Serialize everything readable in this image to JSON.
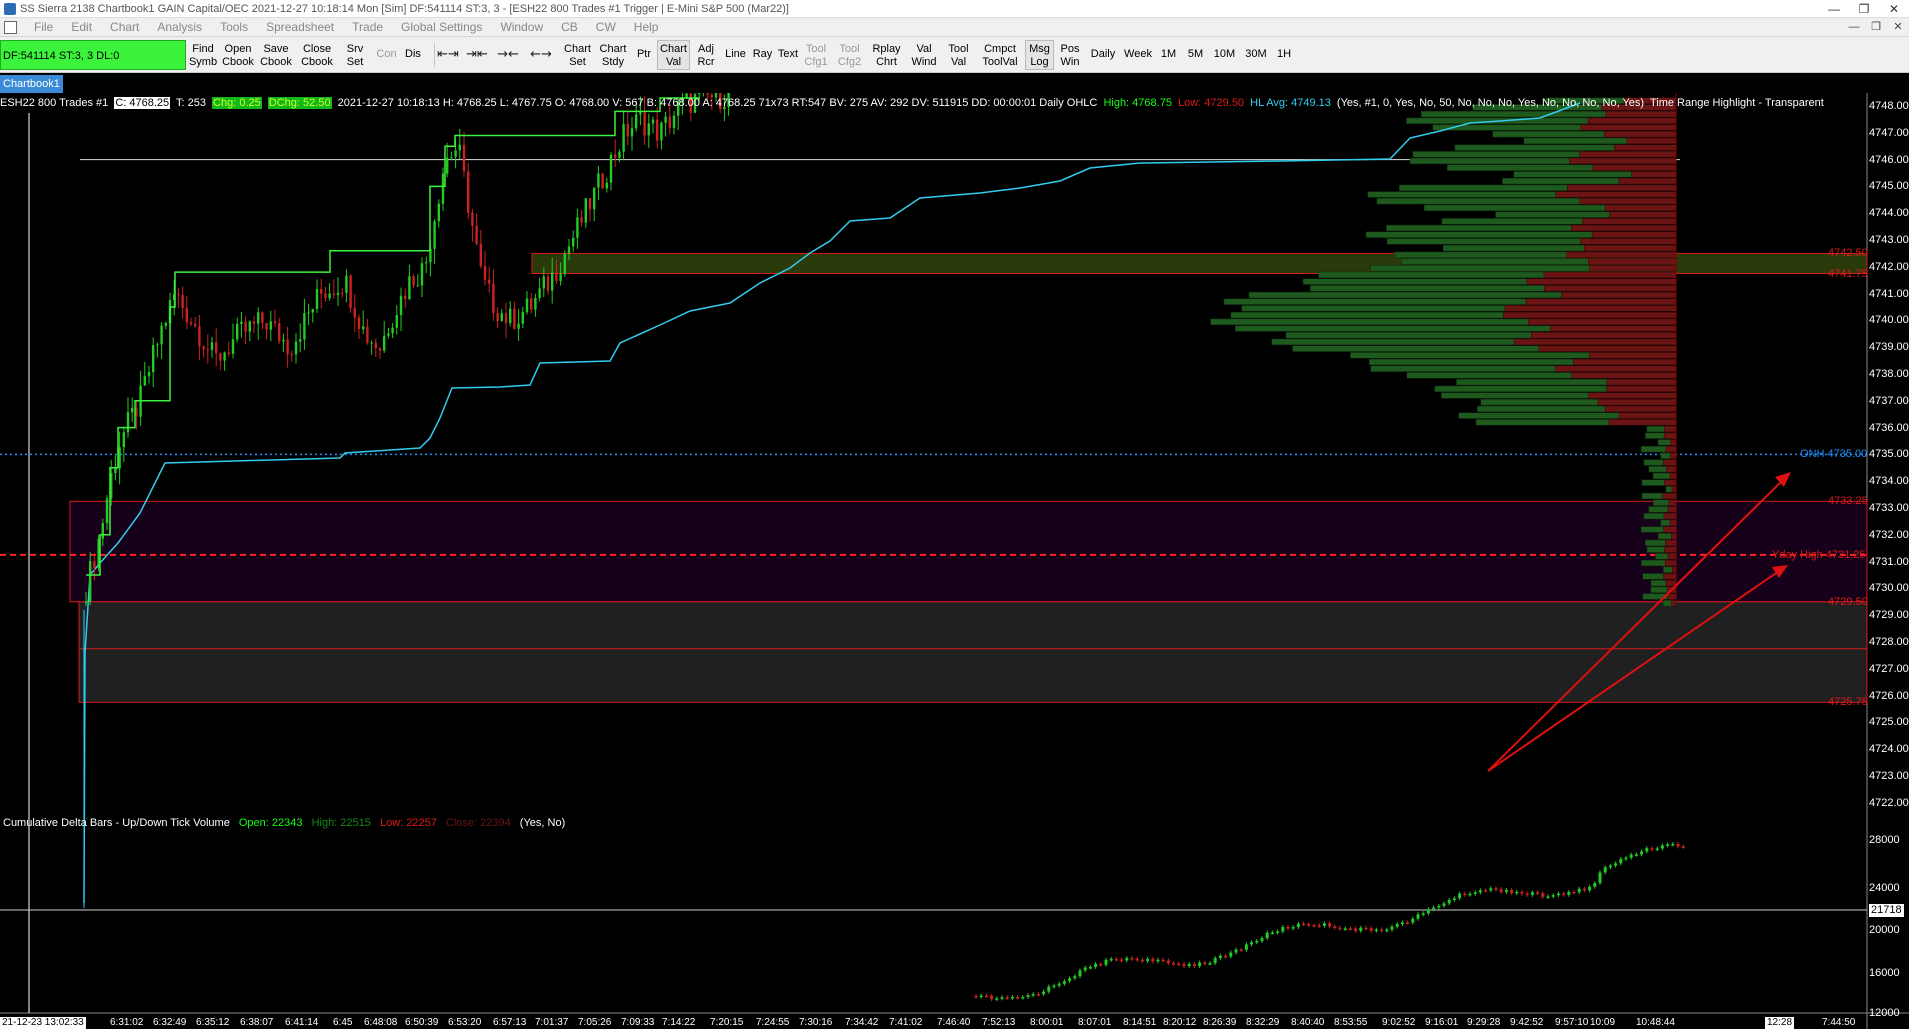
{
  "window": {
    "title": "SS Sierra 2138 Chartbook1  GAIN Capital/OEC 2021-12-27  10:18:14 Mon [Sim]  DF:541114  ST:3, 3  - [ESH22  800 Trades  #1  Trigger | E-Mini S&P 500 (Mar22)]"
  },
  "menu": [
    "File",
    "Edit",
    "Chart",
    "Analysis",
    "Tools",
    "Spreadsheet",
    "Trade",
    "Global Settings",
    "Window",
    "CB",
    "CW",
    "Help"
  ],
  "toolbar": {
    "status": "DF:541114  ST:3, 3  DL:0",
    "buttons": [
      {
        "label": "Find\nSymb",
        "dim": false
      },
      {
        "label": "Open\nCbook",
        "dim": false
      },
      {
        "label": "Save\nCbook",
        "dim": false
      },
      {
        "label": "Close\nCbook",
        "dim": false
      },
      {
        "label": "Srv\nSet",
        "dim": false
      },
      {
        "label": "Con",
        "dim": true
      },
      {
        "label": "Dis",
        "dim": false
      }
    ],
    "buttons2": [
      {
        "label": "Chart\nSet",
        "dim": false
      },
      {
        "label": "Chart\nStdy",
        "dim": false
      },
      {
        "label": "Ptr",
        "dim": false
      },
      {
        "label": "Chart\nVal",
        "dim": false,
        "active": true
      },
      {
        "label": "Adj\nRcr",
        "dim": false
      },
      {
        "label": "Line",
        "dim": false
      },
      {
        "label": "Ray",
        "dim": false
      },
      {
        "label": "Text",
        "dim": false
      },
      {
        "label": "Tool\nCfg1",
        "dim": true
      },
      {
        "label": "Tool\nCfg2",
        "dim": true
      },
      {
        "label": "Rplay\nChrt",
        "dim": false
      },
      {
        "label": "Val\nWind",
        "dim": false
      },
      {
        "label": "Tool\nVal",
        "dim": false
      },
      {
        "label": "Cmpct\nToolVal",
        "dim": false
      },
      {
        "label": "Msg\nLog",
        "dim": false,
        "active": true
      },
      {
        "label": "Pos\nWin",
        "dim": false
      },
      {
        "label": "Daily",
        "dim": false
      },
      {
        "label": "Week",
        "dim": false
      },
      {
        "label": "1M",
        "dim": false
      },
      {
        "label": "5M",
        "dim": false
      },
      {
        "label": "10M",
        "dim": false
      },
      {
        "label": "30M",
        "dim": false
      },
      {
        "label": "1H",
        "dim": false
      }
    ],
    "icons": [
      "zoom-in-horizontal-icon",
      "zoom-out-horizontal-icon",
      "compress-bars-icon",
      "expand-bars-icon"
    ]
  },
  "tab": "Chartbook1",
  "chart": {
    "header": {
      "symbol": "ESH22  800 Trades  #1",
      "c": "C: 4768.25",
      "t": "T: 253",
      "chg": "Chg: 0.25",
      "dchg": "DChg: 52.50",
      "info": "2021-12-27 10:18:13  H: 4768.25  L: 4767.75  O: 4768.00  V: 567  B: 4768.00  A: 4768.25  71x73  RT:547  BV: 275  AV: 292  DV: 511915  DD: 00:00:01  Daily OHLC",
      "high": "High: 4768.75",
      "low": "Low: 4729.50",
      "hlavg": "HL Avg: 4749.13",
      "flags": "(Yes, #1, 0, Yes, No, 50, No, No, No, Yes, No, No, No, No, Yes)",
      "trh": "Time Range Highlight - Transparent"
    },
    "subgraph": {
      "name": "Cumulative Delta Bars - Up/Down Tick Volume",
      "open": "Open: 22343",
      "high": "High: 22515",
      "low": "Low: 22257",
      "close": "Close: 22394",
      "flags": "(Yes, No)"
    },
    "price_axis": [
      "4748.00",
      "4747.00",
      "4746.00",
      "4745.00",
      "4744.00",
      "4743.00",
      "4742.00",
      "4741.00",
      "4740.00",
      "4739.00",
      "4738.00",
      "4737.00",
      "4736.00",
      "4735.00",
      "4734.00",
      "4733.00",
      "4732.00",
      "4731.00",
      "4730.00",
      "4729.00",
      "4728.00",
      "4727.00",
      "4726.00",
      "4725.00",
      "4724.00",
      "4723.00",
      "4722.00"
    ],
    "delta_axis": [
      "28000",
      "24000",
      "20000",
      "16000",
      "12000"
    ],
    "delta_marker": "21718",
    "levels": [
      {
        "label": "4742.50",
        "color": "#d81a1a"
      },
      {
        "label": "4741.75",
        "color": "#d81a1a"
      },
      {
        "label": "ONH  4735.00",
        "color": "#1e8fff"
      },
      {
        "label": "4733.25",
        "color": "#d81a1a"
      },
      {
        "label": "Yday High  4731.25",
        "color": "#d81a1a"
      },
      {
        "label": "4729.50",
        "color": "#d81a1a"
      },
      {
        "label": "4725.75",
        "color": "#d81a1a"
      }
    ],
    "time_axis": [
      "21-12-23  13:02:33",
      "6:31:02",
      "6:32:49",
      "6:35:12",
      "6:38:07",
      "6:41:14",
      "6:45",
      "6:48:08",
      "6:50:39",
      "6:53:20",
      "6:57:13",
      "7:01:37",
      "7:05:26",
      "7:09:33",
      "7:14:22",
      "7:20:15",
      "7:24:55",
      "7:30:16",
      "7:34:42",
      "7:41:02",
      "7:46:40",
      "7:52:13",
      "8:00:01",
      "8:07:01",
      "8:14:51",
      "8:20:12",
      "8:26:39",
      "8:32:29",
      "8:40:40",
      "8:53:55",
      "9:02:52",
      "9:16:01",
      "9:29:28",
      "9:42:52",
      "9:57:10",
      "10:09",
      "10:48:44",
      "12:28",
      "7:44:50"
    ],
    "colors": {
      "up_bar": "#22cc22",
      "down_bar": "#cc2222",
      "vwap": "#33ccee",
      "level_red": "#d81a1a",
      "level_blue": "#1e8fff",
      "volume_profile_green": "#1e5a1e",
      "volume_profile_red": "#6a1414"
    }
  }
}
